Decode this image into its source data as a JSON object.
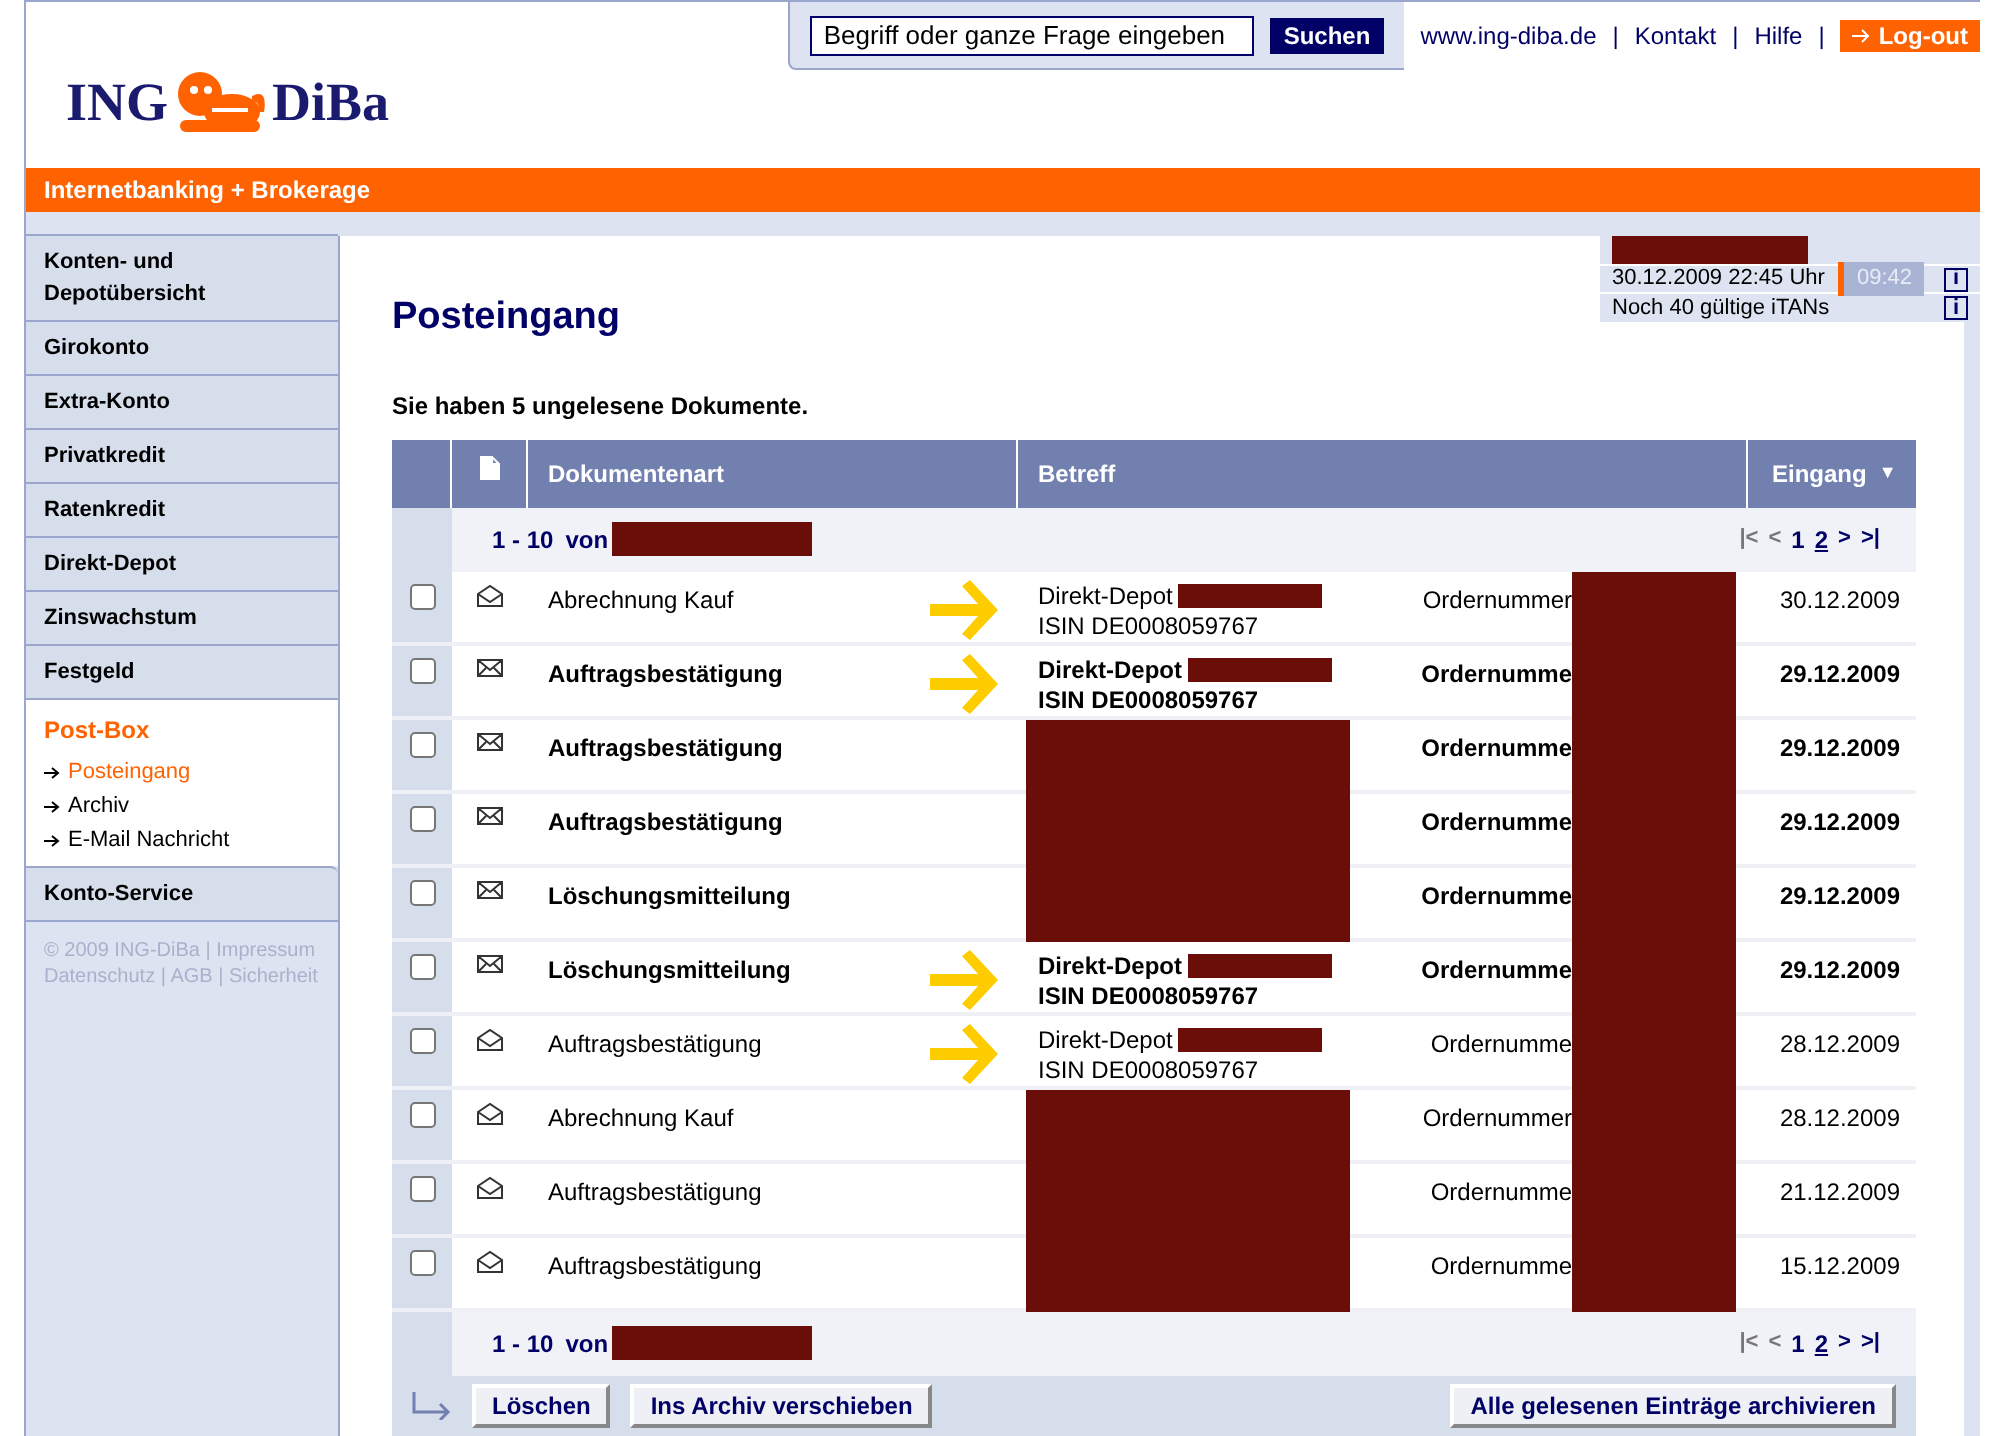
{
  "header": {
    "logo_left": "ING",
    "logo_right": "DiBa",
    "search": {
      "placeholder": "Begriff oder ganze Frage eingeben"
    },
    "search_button": "Suchen",
    "links": [
      "www.ing-diba.de",
      "Kontakt",
      "Hilfe"
    ],
    "separator": "|",
    "logout": "Log-out"
  },
  "banner": "Internetbanking + Brokerage",
  "sidebar": {
    "items": [
      {
        "label": "Konten- und Depotübersicht"
      },
      {
        "label": "Girokonto"
      },
      {
        "label": "Extra-Konto"
      },
      {
        "label": "Privatkredit"
      },
      {
        "label": "Ratenkredit"
      },
      {
        "label": "Direkt-Depot"
      },
      {
        "label": "Zinswachstum"
      },
      {
        "label": "Festgeld"
      }
    ],
    "section": {
      "label": "Post-Box",
      "children": [
        {
          "label": "Posteingang",
          "selected": true
        },
        {
          "label": "Archiv",
          "selected": false
        },
        {
          "label": "E-Mail Nachricht",
          "selected": false
        }
      ]
    },
    "service": "Konto-Service",
    "footer_links": [
      "© 2009 ING-DiBa | Impressum",
      "Datenschutz | AGB | Sicherheit"
    ]
  },
  "session": {
    "datetime": "30.12.2009 22:45 Uhr",
    "timer": "09:42",
    "itans": "Noch 40 gültige iTANs",
    "info_datetime": "i",
    "info_itans": "i"
  },
  "title": "Posteingang",
  "summary": "Sie haben 5 ungelesene Dokumente.",
  "table": {
    "columns": [
      "Dokumentenart",
      "Betreff",
      "Eingang"
    ],
    "sort_indicator": "▼",
    "pagination_top": {
      "range": "1 - 10",
      "of": "von",
      "first": "|<",
      "prev": "<",
      "pages": [
        {
          "label": "1",
          "selected": true
        },
        {
          "label": "2",
          "selected": false
        }
      ],
      "next": ">",
      "last": ">|"
    },
    "pagination_bottom": {
      "range": "1 - 10",
      "of": "von",
      "first": "|<",
      "prev": "<",
      "pages": [
        {
          "label": "1",
          "selected": true
        },
        {
          "label": "2",
          "selected": false
        }
      ],
      "next": ">",
      "last": ">|"
    },
    "rows": [
      {
        "type": "Abrechnung Kauf",
        "unread": false,
        "arrow": true,
        "subject": [
          "Direkt-Depot",
          "ISIN DE0008059767"
        ],
        "order": "Ordernummer",
        "date": "30.12.2009"
      },
      {
        "type": "Auftragsbestätigung",
        "unread": true,
        "arrow": true,
        "subject": [
          "Direkt-Depot",
          "ISIN DE0008059767"
        ],
        "order": "Ordernumme",
        "date": "29.12.2009"
      },
      {
        "type": "Auftragsbestätigung",
        "unread": true,
        "arrow": false,
        "order": "Ordernumme",
        "date": "29.12.2009"
      },
      {
        "type": "Auftragsbestätigung",
        "unread": true,
        "arrow": false,
        "order": "Ordernumme",
        "date": "29.12.2009"
      },
      {
        "type": "Löschungsmitteilung",
        "unread": true,
        "arrow": false,
        "order": "Ordernumme",
        "date": "29.12.2009"
      },
      {
        "type": "Löschungsmitteilung",
        "unread": true,
        "arrow": true,
        "subject": [
          "Direkt-Depot",
          "ISIN DE0008059767"
        ],
        "order": "Ordernumme",
        "date": "29.12.2009"
      },
      {
        "type": "Auftragsbestätigung",
        "unread": false,
        "arrow": true,
        "subject": [
          "Direkt-Depot",
          "ISIN DE0008059767"
        ],
        "order": "Ordernumme",
        "date": "28.12.2009"
      },
      {
        "type": "Abrechnung Kauf",
        "unread": false,
        "arrow": false,
        "order": "Ordernummer",
        "date": "28.12.2009"
      },
      {
        "type": "Auftragsbestätigung",
        "unread": false,
        "arrow": false,
        "order": "Ordernumme",
        "date": "21.12.2009"
      },
      {
        "type": "Auftragsbestätigung",
        "unread": false,
        "arrow": false,
        "order": "Ordernumme",
        "date": "15.12.2009"
      }
    ]
  },
  "actions": [
    "Löschen",
    "Ins Archiv verschieben"
  ],
  "archive_all": "Alle gelesenen Einträge archivieren"
}
